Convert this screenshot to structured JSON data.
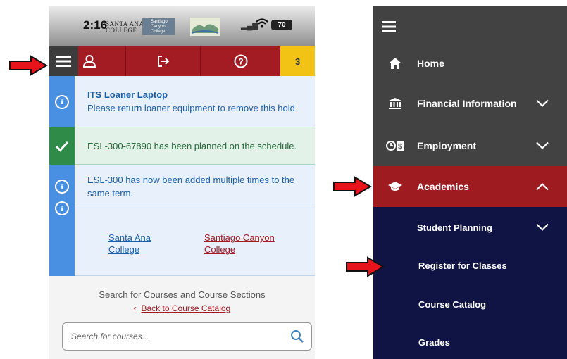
{
  "colors": {
    "red_brand": "#a31c24",
    "badge_yellow": "#f2c315",
    "info_blue": "#4a90e2",
    "success_green": "#2e8b48",
    "menu_gray": "#424242",
    "menu_navy": "#0f1445",
    "arrow_red": "#e8141c"
  },
  "phone": {
    "status_bar": {
      "time": "2:16",
      "logo_santa_ana": "SANTA ANA COLLEGE",
      "logo_santiago": "Santiago Canyon College",
      "battery": "70"
    },
    "top_nav": {
      "menu_icon": "hamburger-icon",
      "user_icon": "user-icon",
      "logout_icon": "sign-out-icon",
      "help_icon": "question-circle-icon",
      "notification_count": "3"
    },
    "alerts": [
      {
        "type": "info",
        "icon": "info-circle-icon",
        "title": "ITS Loaner Laptop",
        "message": "Please return loaner equipment to remove this hold"
      },
      {
        "type": "success",
        "icon": "checkmark-icon",
        "message": "ESL-300-67890 has been planned on the schedule."
      },
      {
        "type": "info",
        "icon": "info-circle-icon",
        "message": "ESL-300 has now been added multiple times to the same term."
      }
    ],
    "colleges": {
      "santa_ana": "Santa Ana College",
      "santiago_canyon": "Santiago Canyon College"
    },
    "search": {
      "title": "Search for Courses and Course Sections",
      "back_link": "Back to Course Catalog",
      "placeholder": "Search for courses..."
    }
  },
  "nav_menu": {
    "menu_icon": "hamburger-icon",
    "items": [
      {
        "label": "Home",
        "icon": "home-icon"
      },
      {
        "label": "Financial Information",
        "icon": "bank-icon",
        "chevron": "down"
      },
      {
        "label": "Employment",
        "icon": "money-icon",
        "chevron": "down"
      },
      {
        "label": "Academics",
        "icon": "graduation-cap-icon",
        "chevron": "up",
        "active": true
      }
    ],
    "sub_items": [
      {
        "label": "Student Planning",
        "chevron": "down"
      },
      {
        "label": "Register for Classes"
      },
      {
        "label": "Course Catalog"
      },
      {
        "label": "Grades"
      }
    ]
  }
}
